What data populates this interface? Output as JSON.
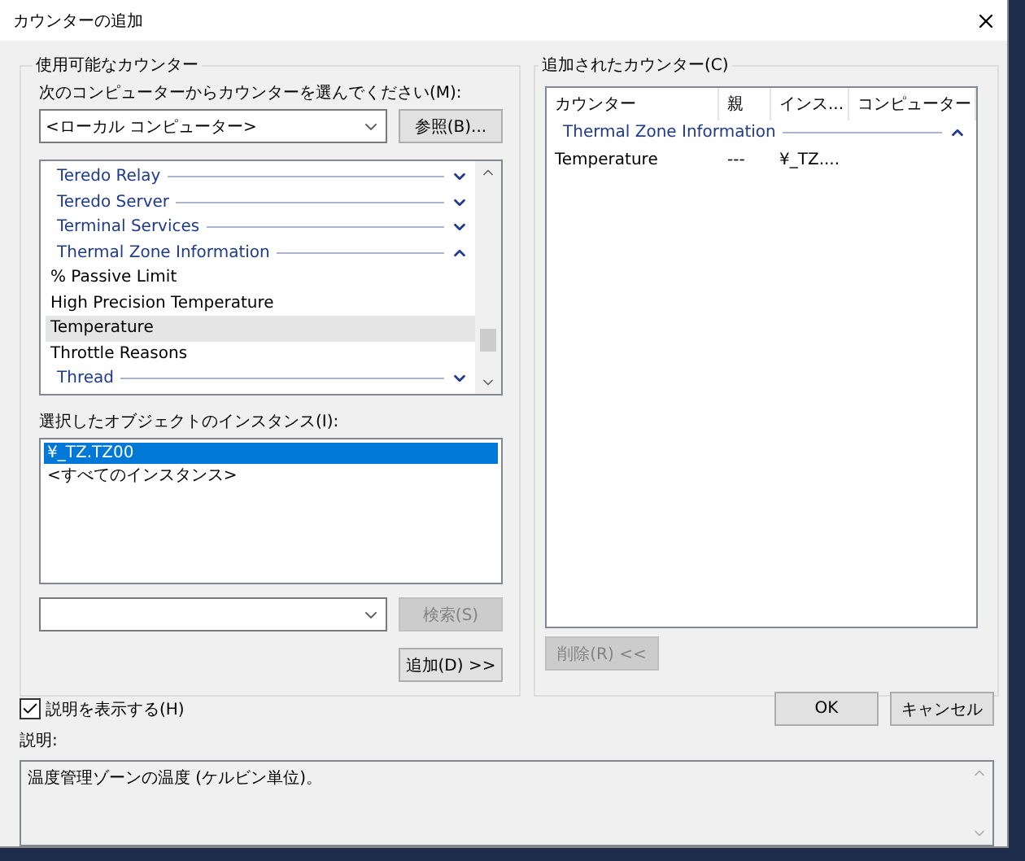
{
  "window": {
    "title": "カウンターの追加"
  },
  "available": {
    "title": "使用可能なカウンター",
    "computer_label": "次のコンピューターからカウンターを選んでください(M):",
    "computer": "<ローカル コンピューター>",
    "browse_button": "参照(B)...",
    "counters": [
      {
        "kind": "category",
        "label": "Teredo Relay",
        "expanded": false
      },
      {
        "kind": "category",
        "label": "Teredo Server",
        "expanded": false
      },
      {
        "kind": "category",
        "label": "Terminal Services",
        "expanded": false
      },
      {
        "kind": "category",
        "label": "Thermal Zone Information",
        "expanded": true
      },
      {
        "kind": "counter",
        "label": "% Passive Limit",
        "selected": false
      },
      {
        "kind": "counter",
        "label": "High Precision Temperature",
        "selected": false
      },
      {
        "kind": "counter",
        "label": "Temperature",
        "selected": true
      },
      {
        "kind": "counter",
        "label": "Throttle Reasons",
        "selected": false
      },
      {
        "kind": "category",
        "label": "Thread",
        "expanded": false
      }
    ],
    "instances_label": "選択したオブジェクトのインスタンス(I):",
    "instances": [
      {
        "label": "¥_TZ.TZ00",
        "selected": true
      },
      {
        "label": "<すべてのインスタンス>",
        "selected": false
      }
    ],
    "search_button": {
      "label": "検索(S)",
      "disabled": true
    },
    "add_button": {
      "label": "追加(D) >>",
      "disabled": false
    }
  },
  "added": {
    "title": "追加されたカウンター(C)",
    "columns": [
      "カウンター",
      "親",
      "インス...",
      "コンピューター"
    ],
    "groups": [
      {
        "label": "Thermal Zone Information",
        "expanded": true,
        "rows": [
          {
            "counter": "Temperature",
            "parent": "---",
            "instance": "¥_TZ...."
          }
        ]
      }
    ],
    "remove_button": {
      "label": "削除(R) <<",
      "disabled": true
    }
  },
  "show_description": {
    "label": "説明を表示する(H)",
    "checked": true
  },
  "buttons": [
    "OK",
    "キャンセル"
  ],
  "description": {
    "label": "説明:",
    "text": "温度管理ゾーンの温度 (ケルビン単位)。"
  }
}
